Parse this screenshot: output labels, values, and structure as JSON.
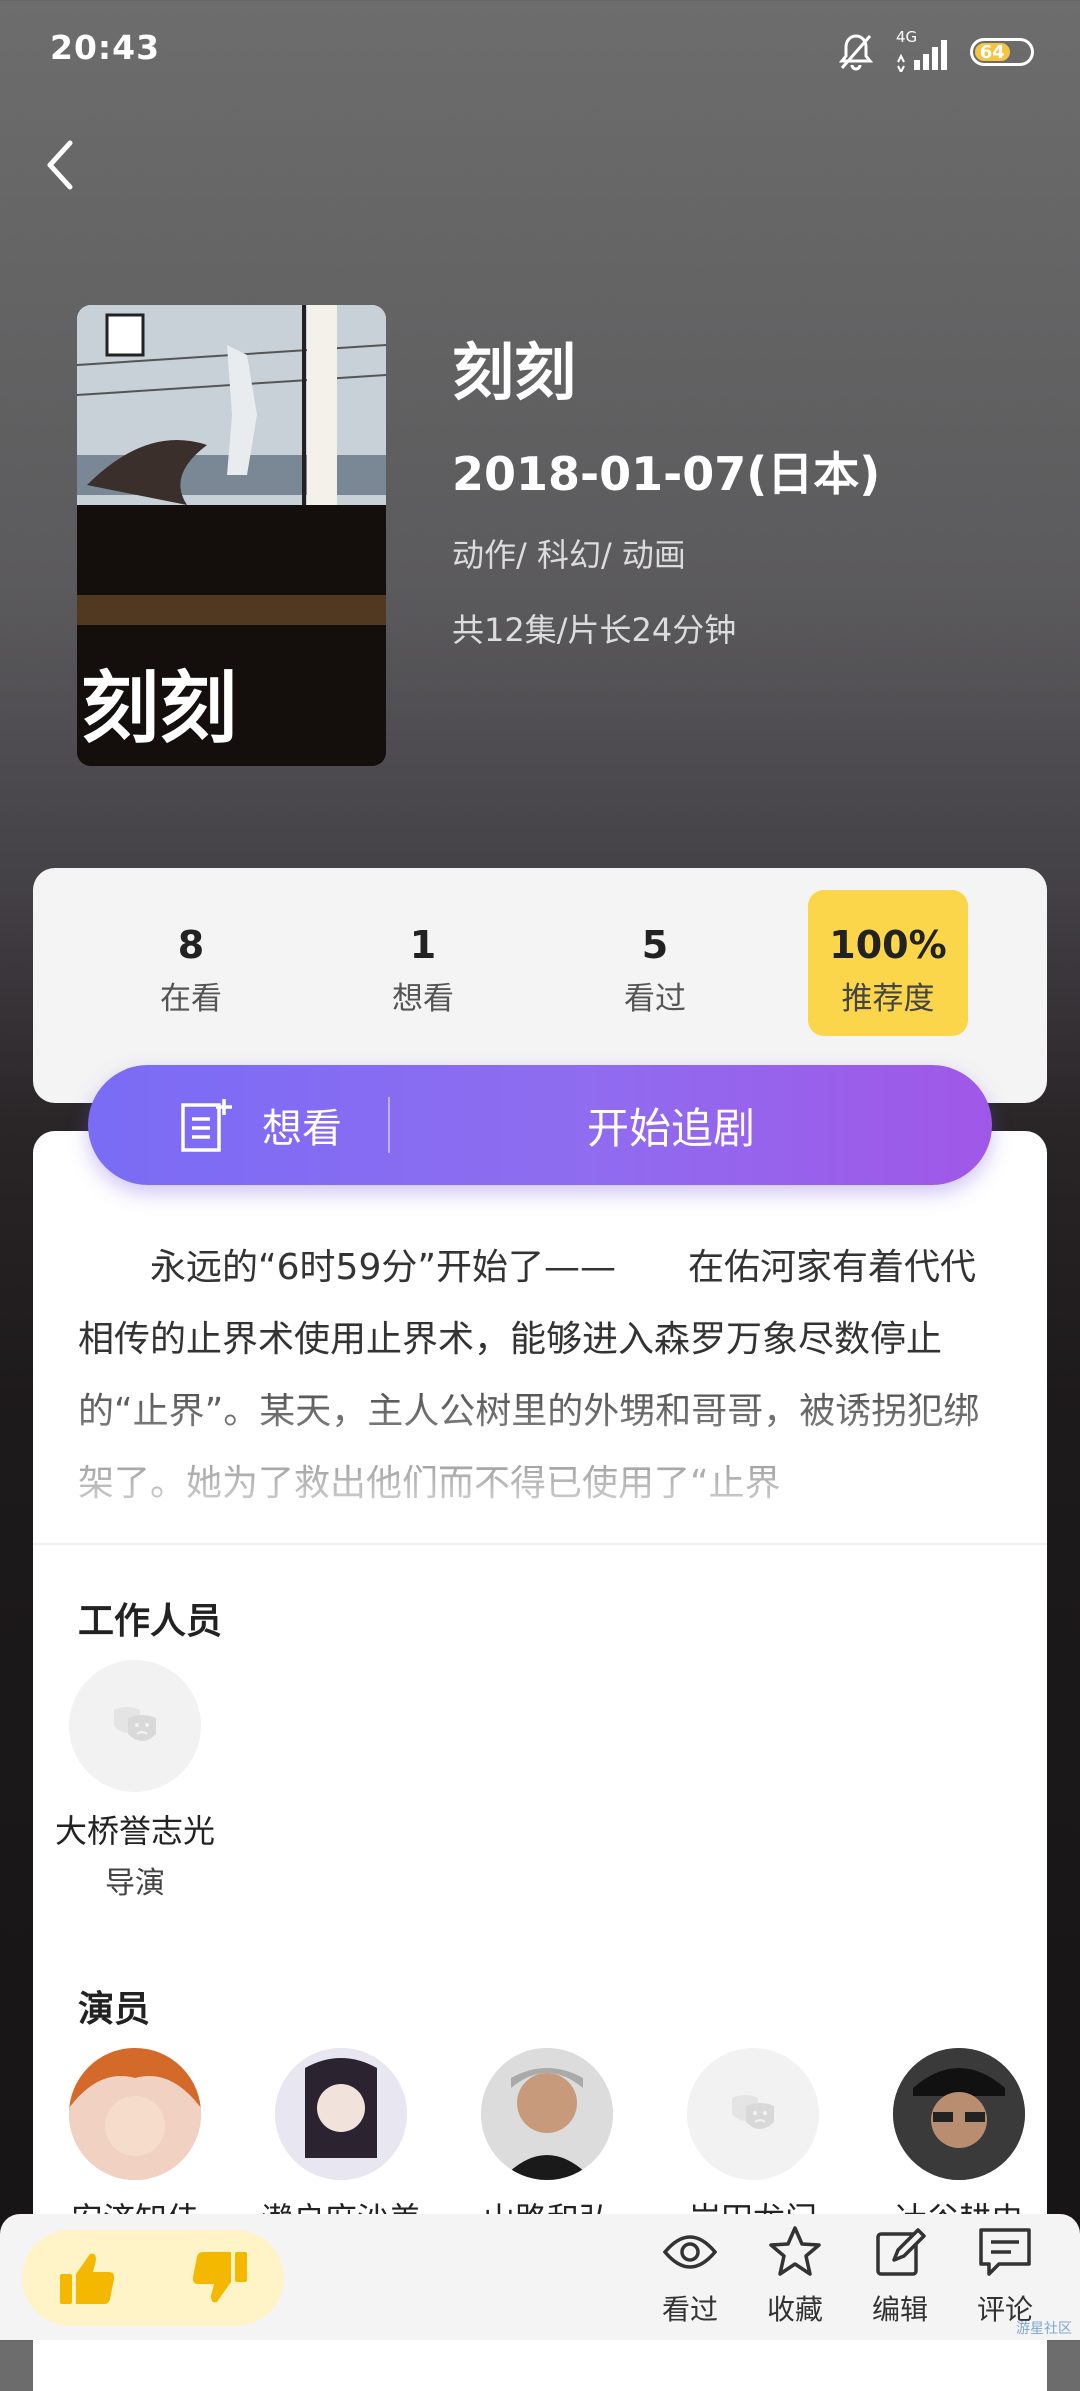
{
  "status": {
    "time": "20:43",
    "network": "4G",
    "battery": "64"
  },
  "header": {
    "title": "刻刻",
    "date": "2018-01-07(日本)",
    "genres": "动作/ 科幻/ 动画",
    "episodes": "共12集/片长24分钟"
  },
  "stats": {
    "watching_num": "8",
    "watching_label": "在看",
    "want_num": "1",
    "want_label": "想看",
    "watched_num": "5",
    "watched_label": "看过",
    "rec_num": "100%",
    "rec_label": "推荐度"
  },
  "actions": {
    "want_label": "想看",
    "start_label": "开始追剧"
  },
  "synopsis": "永远的“6时59分”开始了——　　在佑河家有着代代相传的止界术使用止界术，能够进入森罗万象尽数停止的“止界”。某天，主人公树里的外甥和哥哥，被诱拐犯绑架了。她为了救出他们而不得已使用了“止界",
  "staff": {
    "title": "工作人员",
    "people": [
      {
        "name": "大桥誉志光",
        "role": "导演"
      }
    ]
  },
  "cast": {
    "title": "演员",
    "people": [
      {
        "name": "安济知佳"
      },
      {
        "name": "濑户麻沙美"
      },
      {
        "name": "山路和弘"
      },
      {
        "name": "岩田龙门"
      },
      {
        "name": "辻谷耕史"
      }
    ]
  },
  "bottom": {
    "watched": "看过",
    "favorite": "收藏",
    "edit": "编辑",
    "comment": "评论"
  },
  "watermark": "游星社区",
  "colors": {
    "accent_purple": "#8f6cf0",
    "rec_yellow": "#fbd64a"
  }
}
